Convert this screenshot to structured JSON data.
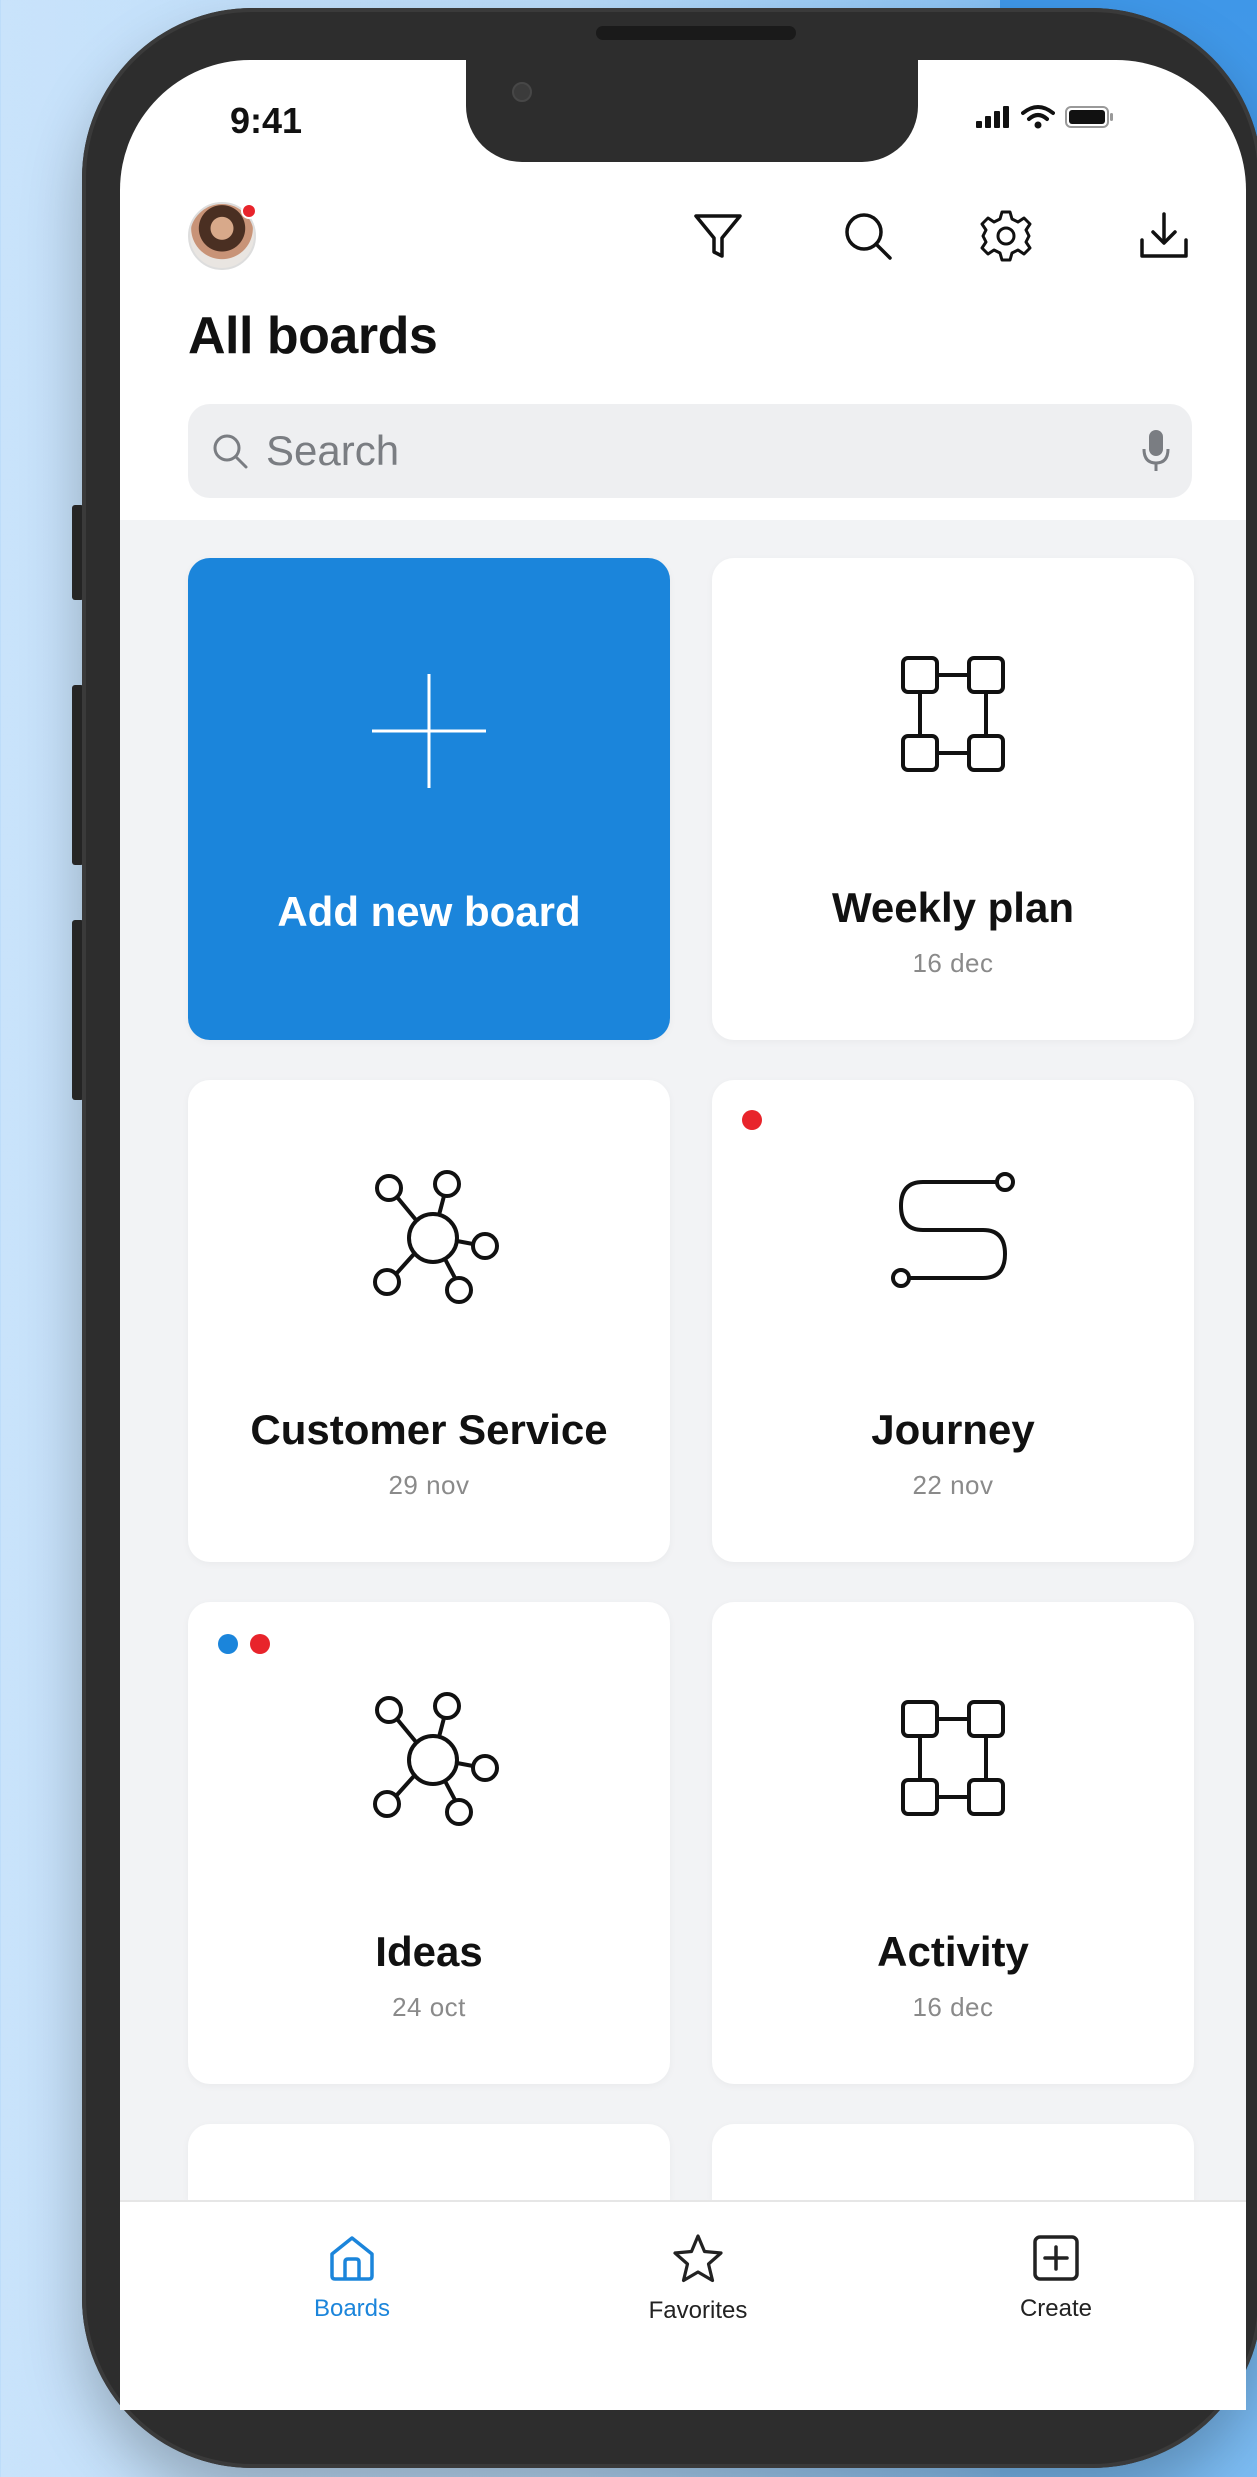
{
  "status_bar": {
    "time": "9:41",
    "signal_icon": "cellular-signal-icon",
    "wifi_icon": "wifi-icon",
    "battery_icon": "battery-icon"
  },
  "header": {
    "avatar": "user-avatar",
    "has_notification": true,
    "actions": [
      {
        "name": "filter",
        "icon": "filter-icon"
      },
      {
        "name": "search",
        "icon": "search-icon"
      },
      {
        "name": "settings",
        "icon": "gear-icon"
      },
      {
        "name": "download",
        "icon": "download-icon"
      }
    ]
  },
  "page": {
    "title": "All boards"
  },
  "search": {
    "placeholder": "Search",
    "value": "",
    "mic_icon": "microphone-icon"
  },
  "boards": [
    {
      "title": "Add new board",
      "date": "",
      "icon": "plus-icon",
      "type": "add"
    },
    {
      "title": "Weekly plan",
      "date": "16 dec",
      "icon": "flowchart-icon",
      "dots": []
    },
    {
      "title": "Customer Service",
      "date": "29 nov",
      "icon": "mindmap-icon",
      "dots": []
    },
    {
      "title": "Journey",
      "date": "22 nov",
      "icon": "journey-path-icon",
      "dots": [
        "#e8242b"
      ]
    },
    {
      "title": "Ideas",
      "date": "24 oct",
      "icon": "mindmap-icon",
      "dots": [
        "#1b85db",
        "#e8242b"
      ]
    },
    {
      "title": "Activity",
      "date": "16 dec",
      "icon": "flowchart-icon",
      "dots": []
    }
  ],
  "tabbar": {
    "tabs": [
      {
        "label": "Boards",
        "icon": "home-icon",
        "active": true
      },
      {
        "label": "Favorites",
        "icon": "star-icon",
        "active": false
      },
      {
        "label": "Create",
        "icon": "plus-square-icon",
        "active": false
      }
    ]
  },
  "colors": {
    "accent": "#1b85db",
    "notification": "#e8242b",
    "text": "#111111",
    "muted": "#8a8a8a"
  }
}
